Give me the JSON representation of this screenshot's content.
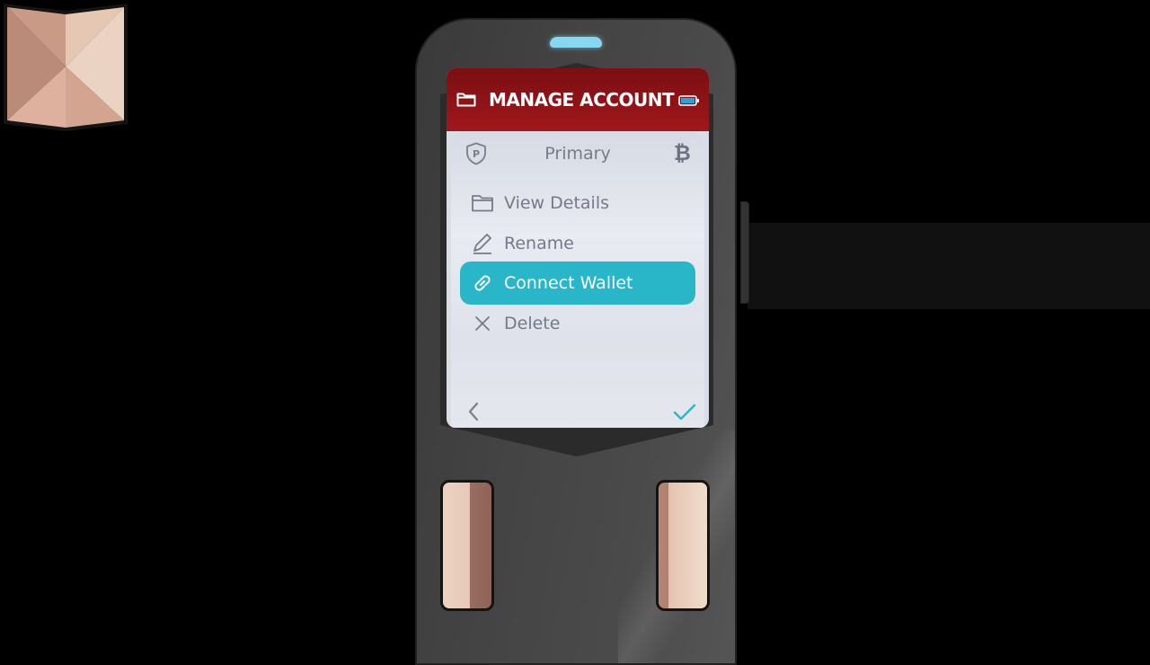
{
  "header": {
    "title": "MANAGE ACCOUNT",
    "icon": "folder-icon",
    "status_icon": "battery-icon"
  },
  "account": {
    "name": "Primary",
    "badge_icon": "shield-p-icon",
    "coin_icon": "bitcoin-icon",
    "coin_symbol": "₿"
  },
  "menu": {
    "items": [
      {
        "label": "View Details",
        "icon": "folder-icon",
        "selected": false
      },
      {
        "label": "Rename",
        "icon": "pencil-icon",
        "selected": false
      },
      {
        "label": "Connect Wallet",
        "icon": "link-icon",
        "selected": true
      },
      {
        "label": "Delete",
        "icon": "close-icon",
        "selected": false
      }
    ]
  },
  "footer": {
    "back_icon": "chevron-left-icon",
    "confirm_icon": "checkmark-icon"
  },
  "colors": {
    "header_bg": "#a0171b",
    "accent": "#29b6c9",
    "device_body": "#444444",
    "led": "#86d7ef"
  }
}
